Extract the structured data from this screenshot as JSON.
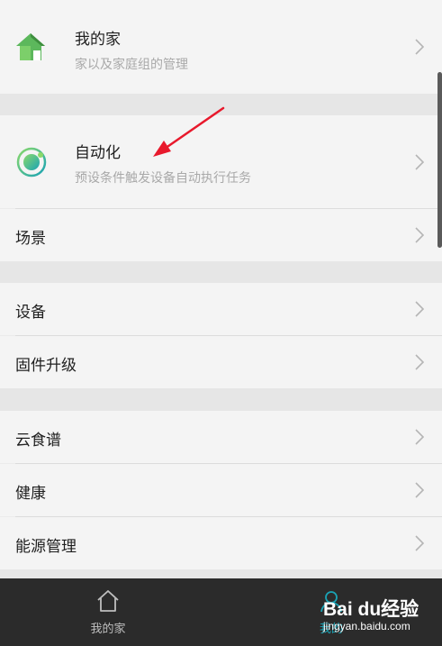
{
  "home_section": {
    "title": "我的家",
    "subtitle": "家以及家庭组的管理",
    "icon": "house-icon",
    "icon_color": "#4caf50"
  },
  "automation_section": {
    "title": "自动化",
    "subtitle": "预设条件触发设备自动执行任务",
    "icon": "automation-ring-icon"
  },
  "scene_item": {
    "title": "场景"
  },
  "device_group": {
    "items": [
      {
        "title": "设备"
      },
      {
        "title": "固件升级"
      }
    ]
  },
  "service_group": {
    "items": [
      {
        "title": "云食谱"
      },
      {
        "title": "健康"
      },
      {
        "title": "能源管理"
      }
    ]
  },
  "tabbar": {
    "tabs": [
      {
        "label": "我的家",
        "icon": "house-outline-icon",
        "active": false
      },
      {
        "label": "我的",
        "icon": "person-outline-icon",
        "active": true
      }
    ],
    "active_color": "#1aa3b5",
    "inactive_color": "#bfbfbf"
  },
  "watermark": {
    "logo": "Bai du经验",
    "url": "jingyan.baidu.com"
  },
  "annotation": {
    "arrow_color": "#e8192c"
  }
}
